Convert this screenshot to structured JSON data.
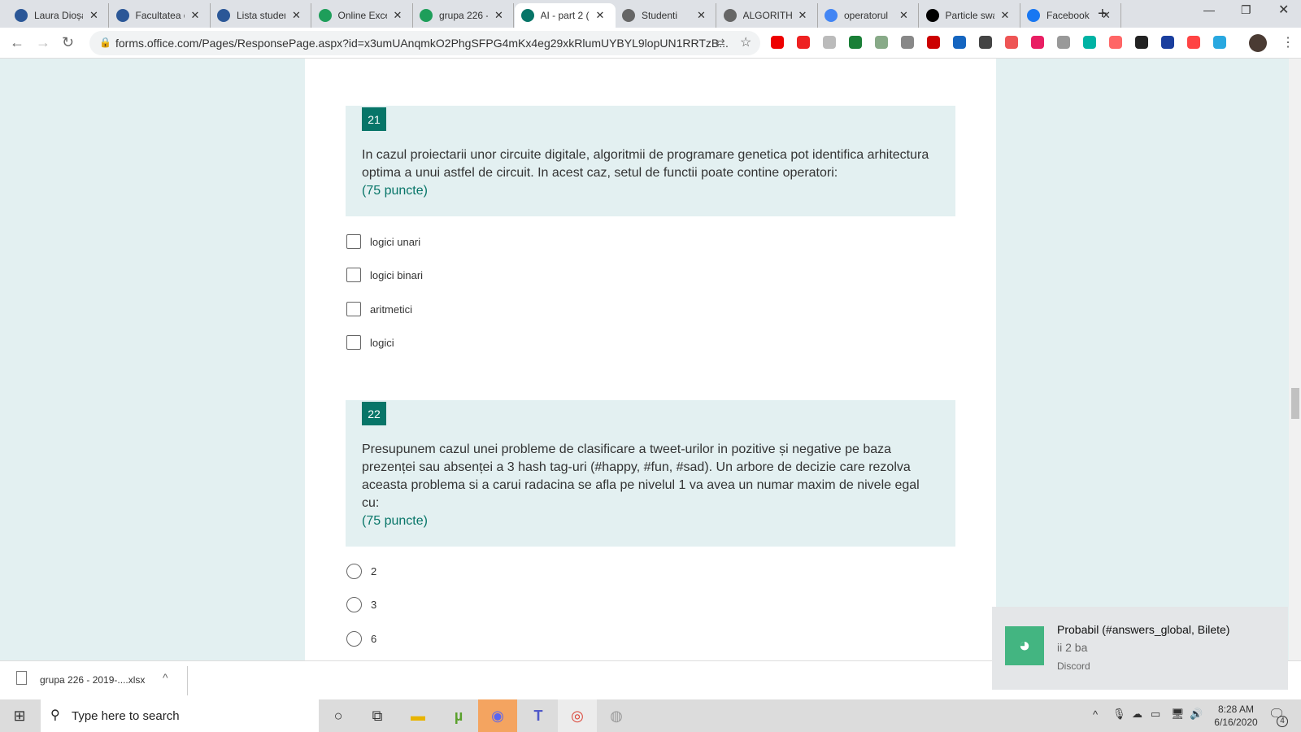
{
  "browser": {
    "tabs": [
      {
        "title": "Laura Dioșan",
        "icon": "university-icon",
        "color": "#2b5797"
      },
      {
        "title": "Facultatea de",
        "icon": "university-icon",
        "color": "#2b5797"
      },
      {
        "title": "Lista studenti",
        "icon": "university-icon",
        "color": "#2b5797"
      },
      {
        "title": "Online Excel",
        "icon": "sheets-icon",
        "color": "#1e9e5a"
      },
      {
        "title": "grupa 226 -",
        "icon": "sheets-icon",
        "color": "#1e9e5a"
      },
      {
        "title": "AI - part 2 (",
        "icon": "forms-icon",
        "color": "#077568",
        "active": true
      },
      {
        "title": "Studenti",
        "icon": "globe-icon",
        "color": "#666"
      },
      {
        "title": "ALGORITHMS",
        "icon": "globe-icon",
        "color": "#666"
      },
      {
        "title": "operatorul",
        "icon": "google-icon",
        "color": "#4285f4"
      },
      {
        "title": "Particle swarm",
        "icon": "wikipedia-icon",
        "color": "#000"
      },
      {
        "title": "Facebook",
        "icon": "facebook-icon",
        "color": "#1877f2"
      }
    ],
    "url": "forms.office.com/Pages/ResponsePage.aspx?id=x3umUAnqmkO2PhgSFPG4mKx4eg29xkRlumUYBYL9lopUN1RRTzB...",
    "extension_colors": [
      "#e00",
      "#e22",
      "#bbb",
      "#1a7f37",
      "#8a8",
      "#888",
      "#c00",
      "#1565c0",
      "#444",
      "#e55",
      "#e91e63",
      "#999",
      "#00b3a4",
      "#f66",
      "#222",
      "#1a3e9e",
      "#f44",
      "#29a8e0"
    ]
  },
  "questions": [
    {
      "number": "21",
      "text": "In cazul proiectarii unor circuite digitale, algoritmii de programare genetica pot identifica arhitectura optima a unui astfel de circuit. In acest caz, setul de functii poate contine operatori:",
      "points": "(75 puncte)",
      "type": "checkbox",
      "options": [
        "logici unari",
        "logici binari",
        "aritmetici",
        "logici"
      ]
    },
    {
      "number": "22",
      "text": "Presupunem cazul unei probleme de clasificare a tweet-urilor in pozitive și negative pe baza prezenței sau absenței a 3 hash tag-uri (#happy, #fun, #sad). Un arbore de decizie care rezolva aceasta problema si a carui radacina se afla pe nivelul 1 va avea un numar maxim de nivele egal cu:",
      "points": "(75 puncte)",
      "type": "radio",
      "options": [
        "2",
        "3",
        "6"
      ]
    }
  ],
  "download": {
    "file": "grupa 226 - 2019-....xlsx"
  },
  "notification": {
    "title": "Probabil (#answers_global, Bilete)",
    "message": "ii 2 ba",
    "app": "Discord",
    "color": "#43b581"
  },
  "taskbar": {
    "search_placeholder": "Type here to search",
    "time": "8:28 AM",
    "date": "6/16/2020",
    "notification_count": "4"
  }
}
